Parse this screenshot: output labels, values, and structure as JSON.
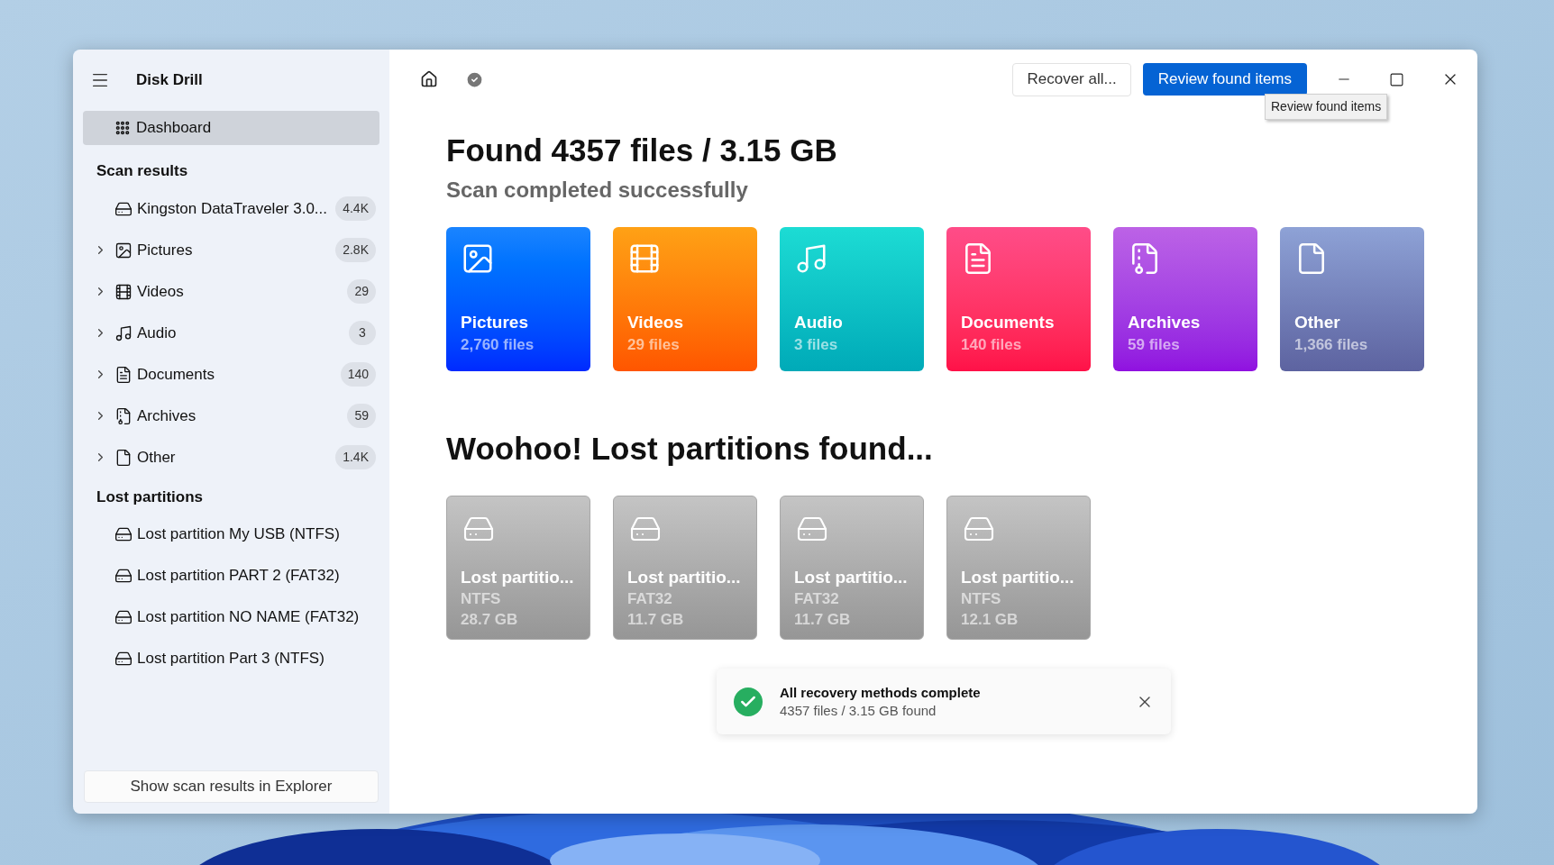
{
  "app": {
    "title": "Disk Drill"
  },
  "sidebar": {
    "dashboard": {
      "label": "Dashboard",
      "selected": true
    },
    "scan_results": {
      "heading": "Scan results",
      "drive": {
        "label": "Kingston DataTraveler 3.0...",
        "count": "4.4K"
      },
      "categories": [
        {
          "kind": "pictures",
          "label": "Pictures",
          "count": "2.8K",
          "expanded": false
        },
        {
          "kind": "videos",
          "label": "Videos",
          "count": "29",
          "expanded": false
        },
        {
          "kind": "audio",
          "label": "Audio",
          "count": "3",
          "expanded": false
        },
        {
          "kind": "documents",
          "label": "Documents",
          "count": "140",
          "expanded": false
        },
        {
          "kind": "archives",
          "label": "Archives",
          "count": "59",
          "expanded": false
        },
        {
          "kind": "other",
          "label": "Other",
          "count": "1.4K",
          "expanded": false
        }
      ]
    },
    "lost_partitions": {
      "heading": "Lost partitions",
      "items": [
        "Lost partition My USB (NTFS)",
        "Lost partition PART 2 (FAT32)",
        "Lost partition NO NAME (FAT32)",
        "Lost partition Part 3 (NTFS)"
      ]
    },
    "footer_button": "Show scan results in Explorer"
  },
  "toolbar": {
    "recover_button": "Recover all...",
    "review_button": "Review found items",
    "tooltip": "Review found items"
  },
  "summary": {
    "title": "Found 4357 files / 3.15 GB",
    "subtitle": "Scan completed successfully"
  },
  "category_cards": [
    {
      "kind": "pictures",
      "label": "Pictures",
      "files": "2,760 files"
    },
    {
      "kind": "videos",
      "label": "Videos",
      "files": "29 files"
    },
    {
      "kind": "audio",
      "label": "Audio",
      "files": "3 files"
    },
    {
      "kind": "documents",
      "label": "Documents",
      "files": "140 files"
    },
    {
      "kind": "archives",
      "label": "Archives",
      "files": "59 files"
    },
    {
      "kind": "other",
      "label": "Other",
      "files": "1,366 files"
    }
  ],
  "partitions": {
    "heading": "Woohoo! Lost partitions found...",
    "cards": [
      {
        "name": "Lost partitio...",
        "filesystem": "NTFS",
        "size": "28.7 GB"
      },
      {
        "name": "Lost partitio...",
        "filesystem": "FAT32",
        "size": "11.7 GB"
      },
      {
        "name": "Lost partitio...",
        "filesystem": "FAT32",
        "size": "11.7 GB"
      },
      {
        "name": "Lost partitio...",
        "filesystem": "NTFS",
        "size": "12.1 GB"
      }
    ]
  },
  "toast": {
    "title": "All recovery methods complete",
    "message": "4357 files / 3.15 GB found"
  }
}
